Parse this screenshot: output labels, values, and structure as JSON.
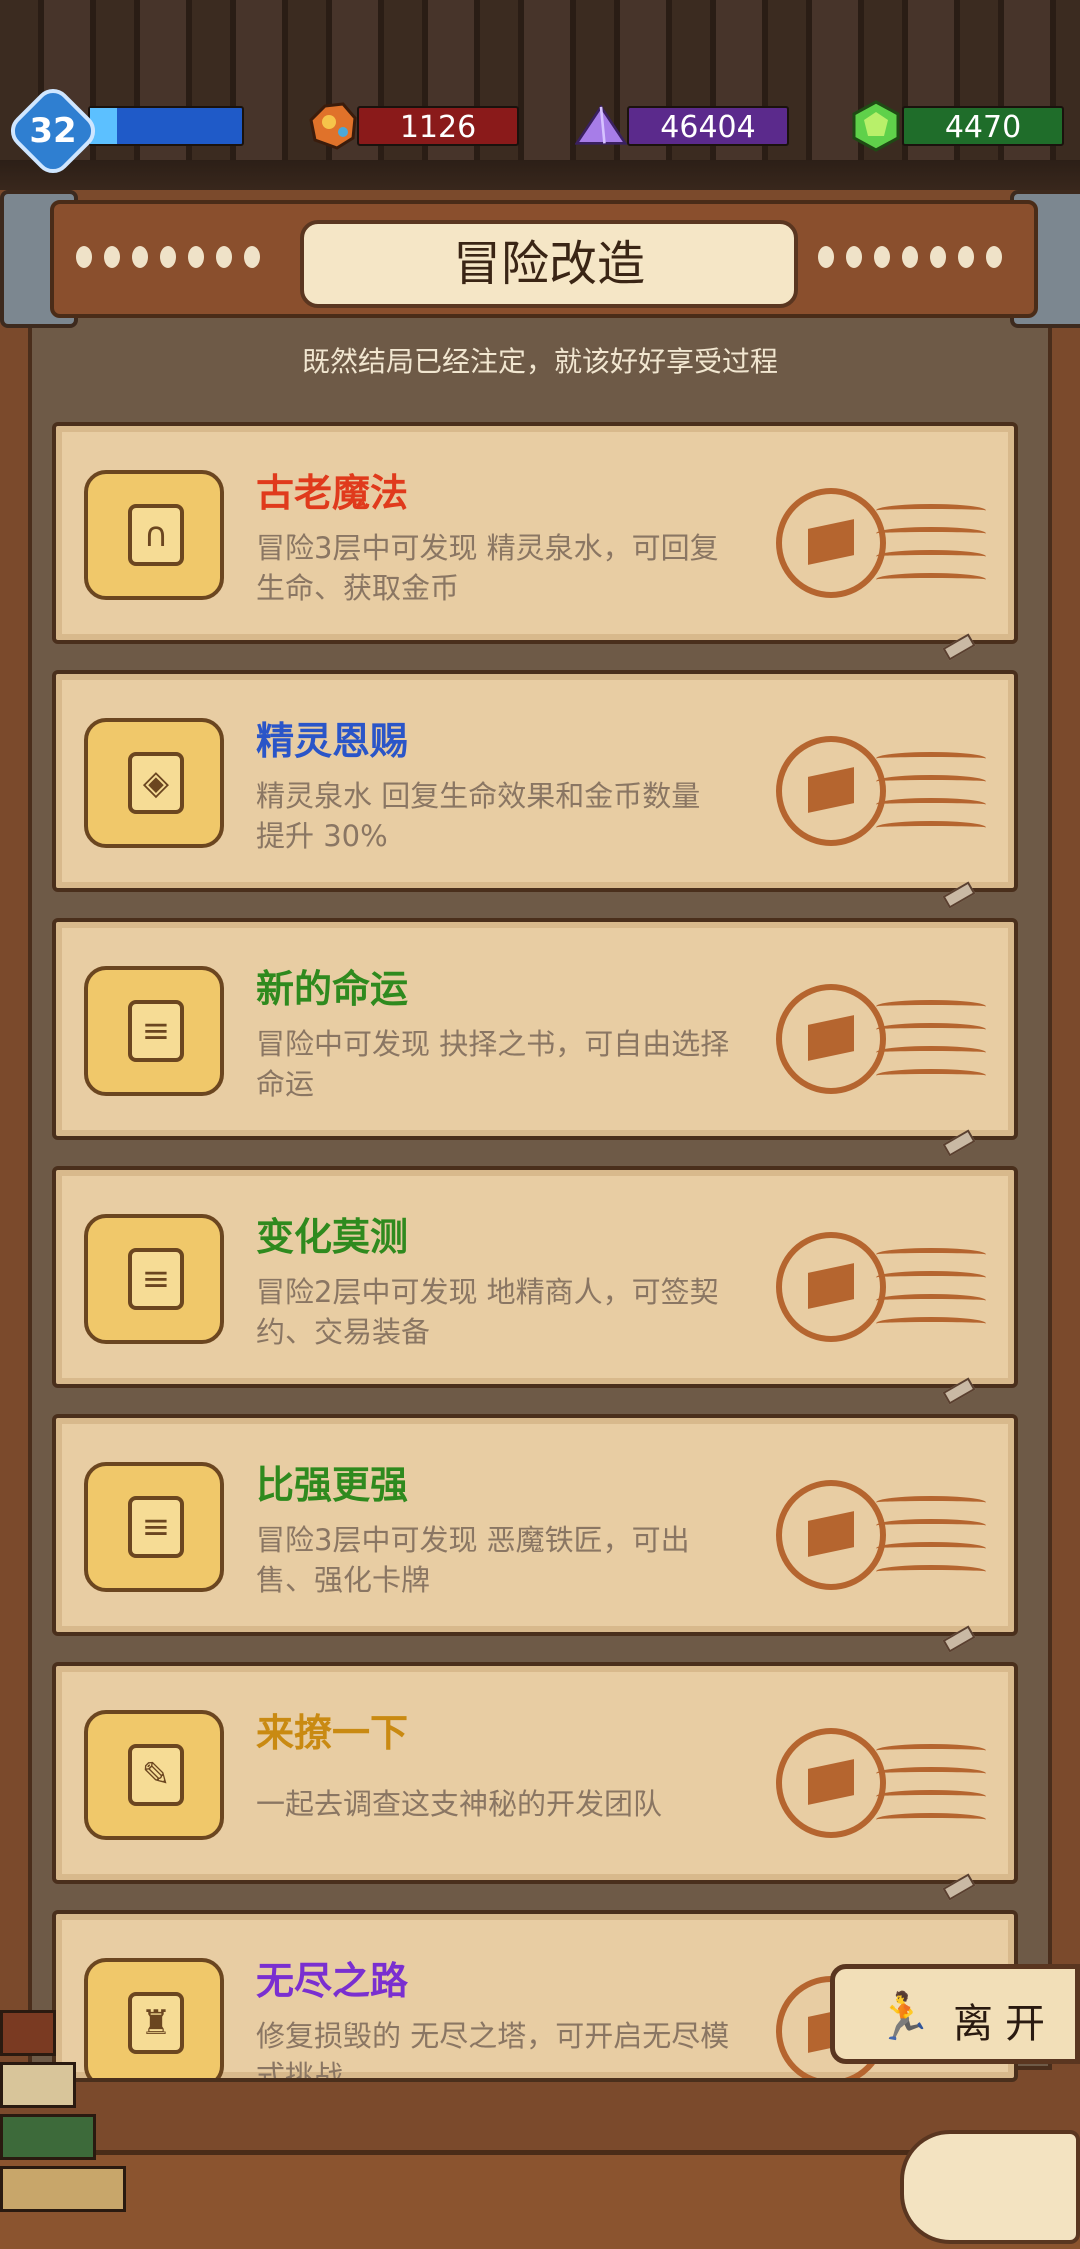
{
  "hud": {
    "level": "32",
    "level_progress": 0.18,
    "currencies": [
      {
        "name": "amber-ore-icon",
        "value": "1126",
        "color": "#8a1a1a"
      },
      {
        "name": "purple-crystal-icon",
        "value": "46404",
        "color": "#5b2a8c"
      },
      {
        "name": "green-gem-icon",
        "value": "4470",
        "color": "#1f6d2a"
      }
    ]
  },
  "header": {
    "title": "冒险改造",
    "subtitle": "既然结局已经注定，就该好好享受过程"
  },
  "cards": [
    {
      "title": "古老魔法",
      "title_color": "#e03a1c",
      "icon": "portal-icon",
      "desc": "冒险3层中可发现 精灵泉水，可回复生命、获取金币"
    },
    {
      "title": "精灵恩赐",
      "title_color": "#2a55c8",
      "icon": "dice-icon",
      "desc": "精灵泉水 回复生命效果和金币数量 提升 30%"
    },
    {
      "title": "新的命运",
      "title_color": "#2f8a1e",
      "icon": "document-icon",
      "desc": "冒险中可发现 抉择之书，可自由选择命运"
    },
    {
      "title": "变化莫测",
      "title_color": "#2f8a1e",
      "icon": "document-icon",
      "desc": "冒险2层中可发现 地精商人，可签契约、交易装备"
    },
    {
      "title": "比强更强",
      "title_color": "#2f8a1e",
      "icon": "document-icon",
      "desc": "冒险3层中可发现 恶魔铁匠，可出售、强化卡牌"
    },
    {
      "title": "来撩一下",
      "title_color": "#c98a12",
      "icon": "wrench-icon",
      "desc": "一起去调查这支神秘的开发团队"
    },
    {
      "title": "无尽之路",
      "title_color": "#7a2fd0",
      "icon": "top-hat-icon",
      "desc": "修复损毁的 无尽之塔，可开启无尽模式挑战"
    }
  ],
  "leave_button": {
    "label": "离开"
  }
}
